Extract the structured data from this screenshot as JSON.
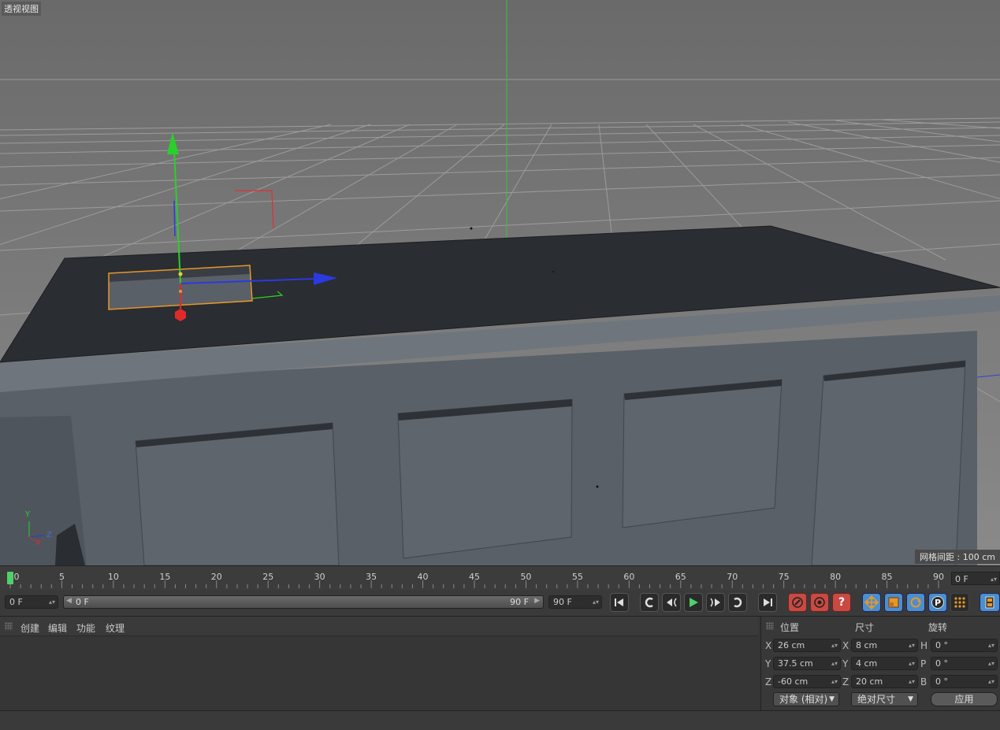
{
  "viewport": {
    "label": "透视视图",
    "grid_spacing": "网格间距 : 100 cm",
    "axis_labels": {
      "y": "Y",
      "x": "X",
      "z": "Z"
    }
  },
  "timeline": {
    "ticks": [
      "0",
      "5",
      "10",
      "15",
      "20",
      "25",
      "30",
      "35",
      "40",
      "45",
      "50",
      "55",
      "60",
      "65",
      "70",
      "75",
      "80",
      "85",
      "90"
    ],
    "current_frame_field": "0 F",
    "playhead_frame": 0
  },
  "transport": {
    "start_field": "0 F",
    "slider_left": "0 F",
    "slider_right": "90 F",
    "end_field": "90 F",
    "buttons": [
      "goto-start",
      "prev-key",
      "prev-frame",
      "play",
      "next-frame",
      "next-key",
      "goto-end",
      "record",
      "autokey",
      "keyframe-selection",
      "move",
      "scale",
      "rotate",
      "parameter",
      "points",
      "timeline-window"
    ]
  },
  "material_panel": {
    "menu": [
      {
        "label": "创建",
        "color": "#e8d27a"
      },
      {
        "label": "编辑",
        "color": "#e8d27a"
      },
      {
        "label": "功能",
        "color": "#c8c8c8"
      },
      {
        "label": "纹理",
        "color": "#e8d27a"
      }
    ]
  },
  "coordinates": {
    "headers": {
      "position": "位置",
      "size": "尺寸",
      "rotation": "旋转"
    },
    "position": {
      "x": "26 cm",
      "y": "37.5 cm",
      "z": "-60 cm"
    },
    "size": {
      "x": "8 cm",
      "y": "4 cm",
      "z": "20 cm"
    },
    "rotation": {
      "h": "0 °",
      "p": "0 °",
      "b": "0 °"
    },
    "axis": {
      "x": "X",
      "y": "Y",
      "z": "Z",
      "h": "H",
      "p": "P",
      "b": "B"
    },
    "mode_dropdown": "对象 (相对)",
    "size_dropdown": "绝对尺寸",
    "apply_button": "应用"
  },
  "colors": {
    "accent_green": "#4ed06a",
    "selection_orange": "#e8962a",
    "axis_x": "#e02a2a",
    "axis_y": "#2ad02a",
    "axis_z": "#2a3ae0"
  }
}
